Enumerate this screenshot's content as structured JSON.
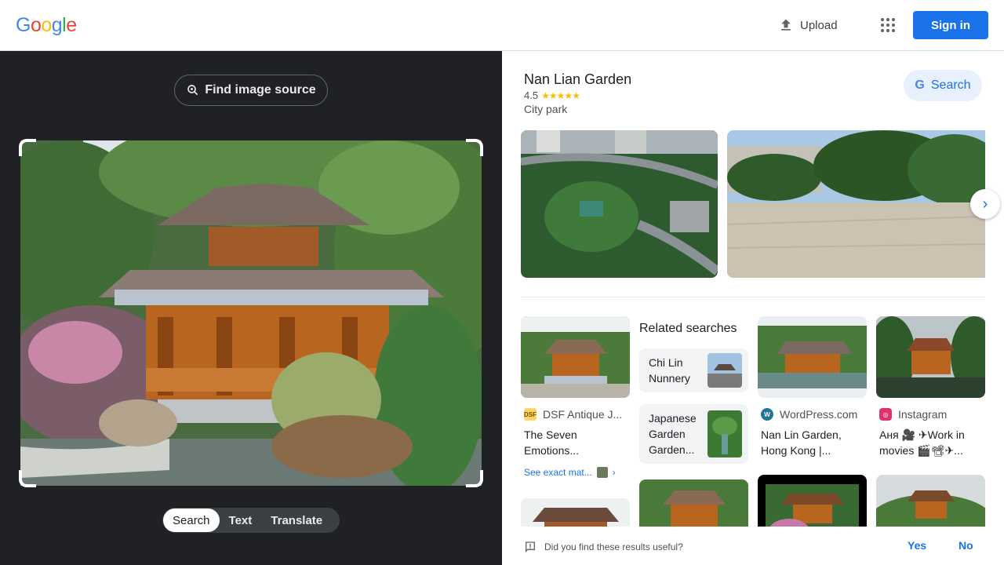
{
  "header": {
    "logo_letters": [
      {
        "ch": "G",
        "color": "#4285F4"
      },
      {
        "ch": "o",
        "color": "#EA4335"
      },
      {
        "ch": "o",
        "color": "#FBBC05"
      },
      {
        "ch": "g",
        "color": "#4285F4"
      },
      {
        "ch": "l",
        "color": "#34A853"
      },
      {
        "ch": "e",
        "color": "#EA4335"
      }
    ],
    "upload_label": "Upload",
    "signin_label": "Sign in"
  },
  "left": {
    "find_source_label": "Find image source",
    "modes": [
      "Search",
      "Text",
      "Translate"
    ],
    "active_mode": "Search"
  },
  "knowledge": {
    "title": "Nan Lian Garden",
    "rating": "4.5",
    "stars": "★★★★★",
    "type": "City park",
    "search_label": "Search"
  },
  "results": [
    {
      "source": "DSF Antique J...",
      "icon_text": "DSF",
      "icon_color": "#fdd663",
      "title": "The Seven Emotions..."
    },
    {
      "source": "WordPress.com",
      "icon_text": "W",
      "icon_color": "#21759b",
      "title": "Nan Lin Garden, Hong Kong |..."
    },
    {
      "source": "Instagram",
      "icon_text": "◎",
      "icon_color": "#e1306c",
      "title": "Аня 🎥 ✈Work in movies 🎬📽✈..."
    }
  ],
  "related": {
    "title": "Related searches",
    "items": [
      {
        "label": "Chi Lin Nunnery"
      },
      {
        "label": "Japanese Garden Garden..."
      }
    ]
  },
  "see_exact": "See exact mat...",
  "feedback": {
    "question": "Did you find these results useful?",
    "yes": "Yes",
    "no": "No"
  }
}
